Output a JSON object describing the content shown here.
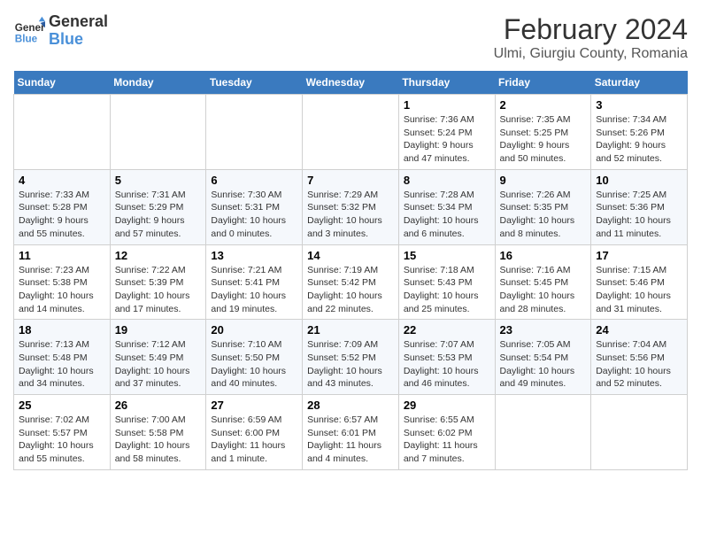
{
  "header": {
    "logo_line1": "General",
    "logo_line2": "Blue",
    "title": "February 2024",
    "subtitle": "Ulmi, Giurgiu County, Romania"
  },
  "days_of_week": [
    "Sunday",
    "Monday",
    "Tuesday",
    "Wednesday",
    "Thursday",
    "Friday",
    "Saturday"
  ],
  "weeks": [
    [
      {
        "num": "",
        "info": ""
      },
      {
        "num": "",
        "info": ""
      },
      {
        "num": "",
        "info": ""
      },
      {
        "num": "",
        "info": ""
      },
      {
        "num": "1",
        "info": "Sunrise: 7:36 AM\nSunset: 5:24 PM\nDaylight: 9 hours and 47 minutes."
      },
      {
        "num": "2",
        "info": "Sunrise: 7:35 AM\nSunset: 5:25 PM\nDaylight: 9 hours and 50 minutes."
      },
      {
        "num": "3",
        "info": "Sunrise: 7:34 AM\nSunset: 5:26 PM\nDaylight: 9 hours and 52 minutes."
      }
    ],
    [
      {
        "num": "4",
        "info": "Sunrise: 7:33 AM\nSunset: 5:28 PM\nDaylight: 9 hours and 55 minutes."
      },
      {
        "num": "5",
        "info": "Sunrise: 7:31 AM\nSunset: 5:29 PM\nDaylight: 9 hours and 57 minutes."
      },
      {
        "num": "6",
        "info": "Sunrise: 7:30 AM\nSunset: 5:31 PM\nDaylight: 10 hours and 0 minutes."
      },
      {
        "num": "7",
        "info": "Sunrise: 7:29 AM\nSunset: 5:32 PM\nDaylight: 10 hours and 3 minutes."
      },
      {
        "num": "8",
        "info": "Sunrise: 7:28 AM\nSunset: 5:34 PM\nDaylight: 10 hours and 6 minutes."
      },
      {
        "num": "9",
        "info": "Sunrise: 7:26 AM\nSunset: 5:35 PM\nDaylight: 10 hours and 8 minutes."
      },
      {
        "num": "10",
        "info": "Sunrise: 7:25 AM\nSunset: 5:36 PM\nDaylight: 10 hours and 11 minutes."
      }
    ],
    [
      {
        "num": "11",
        "info": "Sunrise: 7:23 AM\nSunset: 5:38 PM\nDaylight: 10 hours and 14 minutes."
      },
      {
        "num": "12",
        "info": "Sunrise: 7:22 AM\nSunset: 5:39 PM\nDaylight: 10 hours and 17 minutes."
      },
      {
        "num": "13",
        "info": "Sunrise: 7:21 AM\nSunset: 5:41 PM\nDaylight: 10 hours and 19 minutes."
      },
      {
        "num": "14",
        "info": "Sunrise: 7:19 AM\nSunset: 5:42 PM\nDaylight: 10 hours and 22 minutes."
      },
      {
        "num": "15",
        "info": "Sunrise: 7:18 AM\nSunset: 5:43 PM\nDaylight: 10 hours and 25 minutes."
      },
      {
        "num": "16",
        "info": "Sunrise: 7:16 AM\nSunset: 5:45 PM\nDaylight: 10 hours and 28 minutes."
      },
      {
        "num": "17",
        "info": "Sunrise: 7:15 AM\nSunset: 5:46 PM\nDaylight: 10 hours and 31 minutes."
      }
    ],
    [
      {
        "num": "18",
        "info": "Sunrise: 7:13 AM\nSunset: 5:48 PM\nDaylight: 10 hours and 34 minutes."
      },
      {
        "num": "19",
        "info": "Sunrise: 7:12 AM\nSunset: 5:49 PM\nDaylight: 10 hours and 37 minutes."
      },
      {
        "num": "20",
        "info": "Sunrise: 7:10 AM\nSunset: 5:50 PM\nDaylight: 10 hours and 40 minutes."
      },
      {
        "num": "21",
        "info": "Sunrise: 7:09 AM\nSunset: 5:52 PM\nDaylight: 10 hours and 43 minutes."
      },
      {
        "num": "22",
        "info": "Sunrise: 7:07 AM\nSunset: 5:53 PM\nDaylight: 10 hours and 46 minutes."
      },
      {
        "num": "23",
        "info": "Sunrise: 7:05 AM\nSunset: 5:54 PM\nDaylight: 10 hours and 49 minutes."
      },
      {
        "num": "24",
        "info": "Sunrise: 7:04 AM\nSunset: 5:56 PM\nDaylight: 10 hours and 52 minutes."
      }
    ],
    [
      {
        "num": "25",
        "info": "Sunrise: 7:02 AM\nSunset: 5:57 PM\nDaylight: 10 hours and 55 minutes."
      },
      {
        "num": "26",
        "info": "Sunrise: 7:00 AM\nSunset: 5:58 PM\nDaylight: 10 hours and 58 minutes."
      },
      {
        "num": "27",
        "info": "Sunrise: 6:59 AM\nSunset: 6:00 PM\nDaylight: 11 hours and 1 minute."
      },
      {
        "num": "28",
        "info": "Sunrise: 6:57 AM\nSunset: 6:01 PM\nDaylight: 11 hours and 4 minutes."
      },
      {
        "num": "29",
        "info": "Sunrise: 6:55 AM\nSunset: 6:02 PM\nDaylight: 11 hours and 7 minutes."
      },
      {
        "num": "",
        "info": ""
      },
      {
        "num": "",
        "info": ""
      }
    ]
  ]
}
